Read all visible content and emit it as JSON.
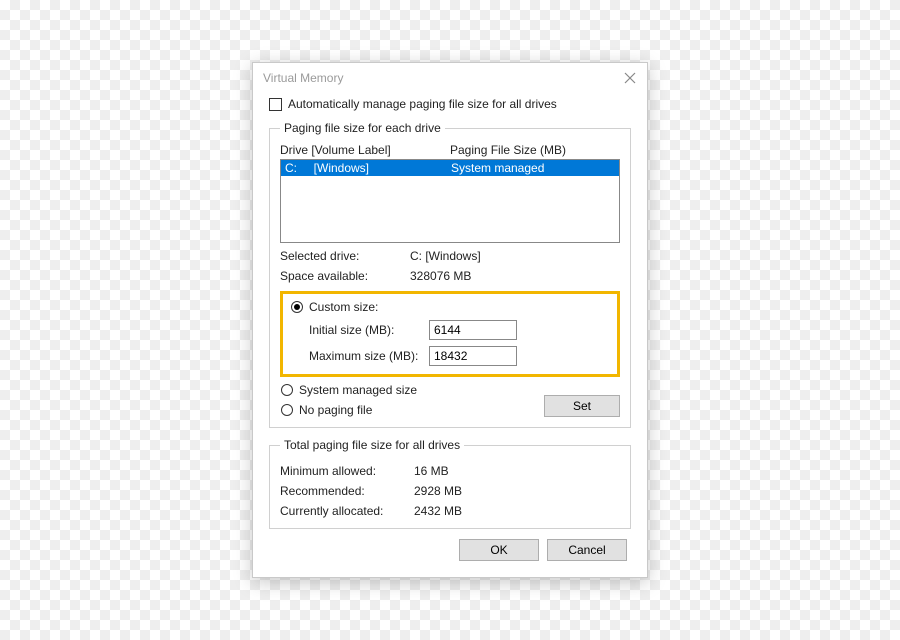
{
  "title": "Virtual Memory",
  "auto_manage_label": "Automatically manage paging file size for all drives",
  "groupbox": {
    "legend": "Paging file size for each drive",
    "header_drive": "Drive  [Volume Label]",
    "header_size": "Paging File Size (MB)",
    "drives": [
      {
        "drive": "C:",
        "label": "[Windows]",
        "size": "System managed"
      }
    ],
    "selected_drive_label": "Selected drive:",
    "selected_drive_value": "C:  [Windows]",
    "space_label": "Space available:",
    "space_value": "328076 MB",
    "custom_label": "Custom size:",
    "initial_label": "Initial size (MB):",
    "initial_value": "6144",
    "max_label": "Maximum size (MB):",
    "max_value": "18432",
    "system_managed_label": "System managed size",
    "no_paging_label": "No paging file",
    "set_label": "Set"
  },
  "totals": {
    "legend": "Total paging file size for all drives",
    "min_label": "Minimum allowed:",
    "min_value": "16 MB",
    "rec_label": "Recommended:",
    "rec_value": "2928 MB",
    "cur_label": "Currently allocated:",
    "cur_value": "2432 MB"
  },
  "buttons": {
    "ok": "OK",
    "cancel": "Cancel"
  }
}
